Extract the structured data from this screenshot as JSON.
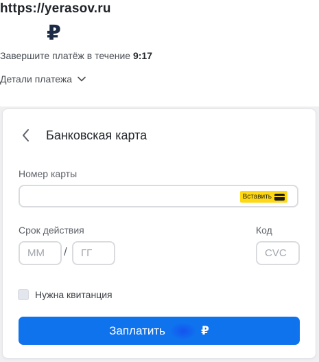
{
  "header": {
    "site_url": "https://yerasov.ru",
    "currency_symbol": "₽",
    "timer_text": "Завершите платёж в течение",
    "timer_value": "9:17",
    "details_link": "Детали платежа"
  },
  "card_form": {
    "title": "Банковская карта",
    "card_number_label": "Номер карты",
    "card_number_value": "",
    "paste_button": "Вставить",
    "expiry_label": "Срок действия",
    "month_placeholder": "ММ",
    "year_placeholder": "ГГ",
    "expiry_separator": "/",
    "cvc_label": "Код",
    "cvc_placeholder": "CVC",
    "receipt_checkbox_label": "Нужна квитанция",
    "receipt_checked": false,
    "pay_button_label": "Заплатить",
    "pay_button_currency": "₽"
  },
  "icons": {
    "back": "chevron-left-icon",
    "details_toggle": "chevron-down-icon",
    "paste": "credit-card-icon"
  },
  "colors": {
    "primary": "#0f73ee",
    "paste_button_bg": "#ffd814",
    "currency": "#1b2b46"
  }
}
